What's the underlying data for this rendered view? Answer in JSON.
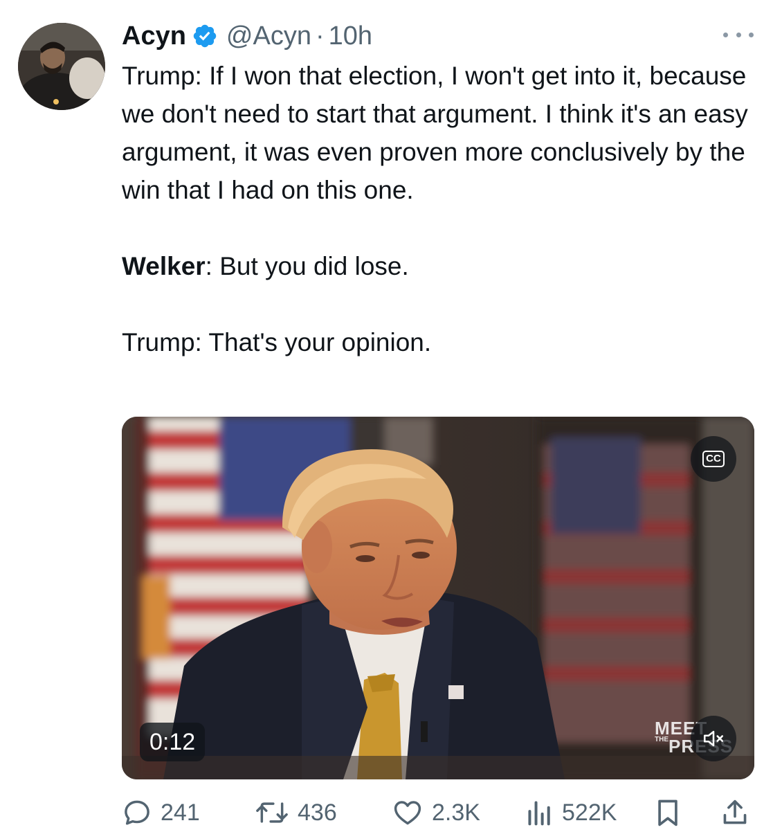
{
  "tweet": {
    "author": {
      "name": "Acyn",
      "handle": "@Acyn",
      "separator": "·",
      "time": "10h",
      "verified": true
    },
    "paragraphs": [
      {
        "speaker": "",
        "text": "Trump: If I won that election, I won't get into it, because we don't need to start that argument. I think it's an easy argument, it was even proven more conclusively by the win that I had on this one."
      },
      {
        "speaker": "Welker",
        "text": ": But you did lose."
      },
      {
        "speaker": "",
        "text": "Trump: That's your opinion."
      }
    ],
    "media": {
      "duration": "0:12",
      "cc_label": "CC",
      "logo_line1": "MEET",
      "logo_small": "THE",
      "logo_line2": "PRESS"
    },
    "stats": {
      "replies": "241",
      "reposts": "436",
      "likes": "2.3K",
      "views": "522K"
    }
  },
  "colors": {
    "verified_blue": "#1d9bf0",
    "muted_text": "#536471",
    "primary_text": "#0f1419"
  },
  "icons": [
    "verified-badge-icon",
    "more-icon",
    "cc-icon",
    "mute-icon",
    "reply-icon",
    "repost-icon",
    "like-icon",
    "views-icon",
    "bookmark-icon",
    "share-icon"
  ]
}
